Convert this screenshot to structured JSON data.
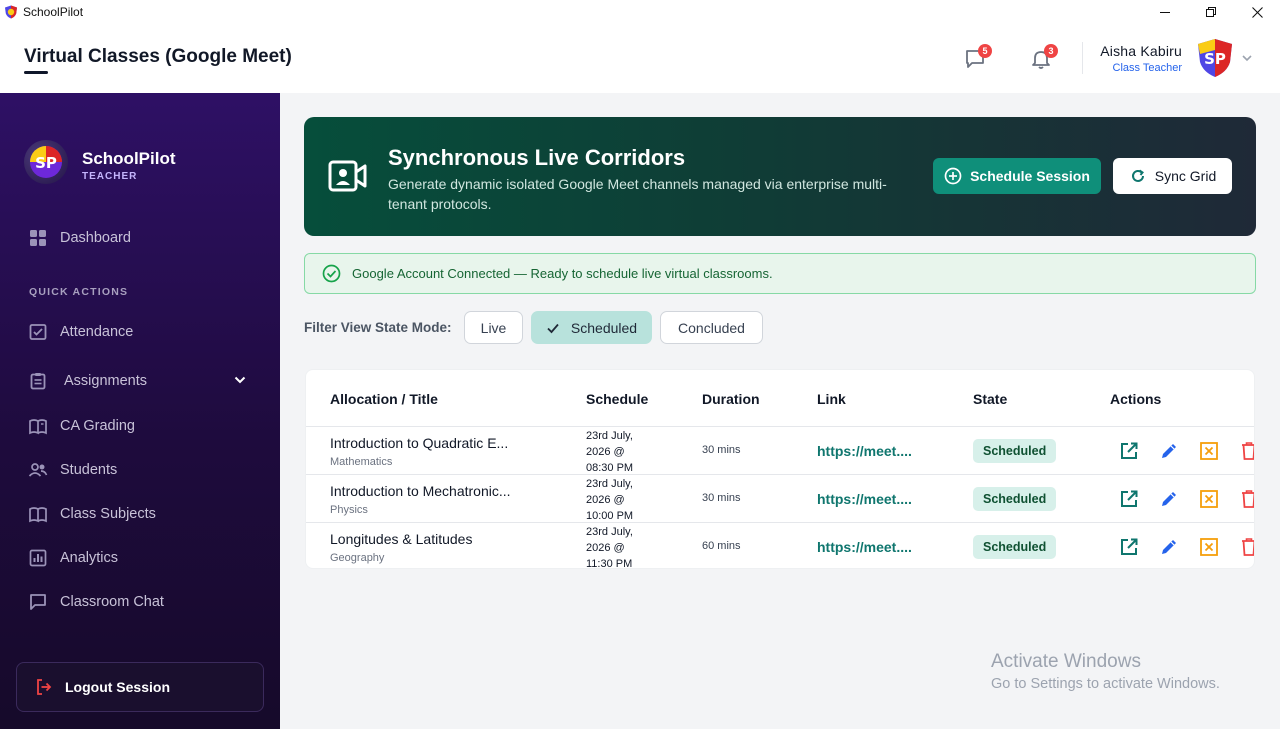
{
  "window": {
    "app_name": "SchoolPilot",
    "controls": [
      "minimize",
      "maximize",
      "close"
    ]
  },
  "header": {
    "title": "Virtual Classes (Google Meet)",
    "messages_badge": "5",
    "notifications_badge": "3",
    "user_name": "Aisha Kabiru",
    "user_role": "Class Teacher",
    "avatar_text": "SP"
  },
  "sidebar": {
    "brand_name": "SchoolPilot",
    "brand_role": "TEACHER",
    "brand_logo_text": "SP",
    "dashboard": "Dashboard",
    "section_label": "QUICK ACTIONS",
    "items": [
      {
        "label": "Attendance",
        "icon": "attendance-icon"
      },
      {
        "label": "Assignments",
        "icon": "assignments-icon"
      },
      {
        "label": "CA Grading",
        "icon": "grading-icon"
      },
      {
        "label": "Students",
        "icon": "students-icon"
      },
      {
        "label": "Class Subjects",
        "icon": "subjects-icon"
      },
      {
        "label": "Analytics",
        "icon": "analytics-icon"
      },
      {
        "label": "Classroom Chat",
        "icon": "chat-icon"
      }
    ],
    "logout": "Logout Session"
  },
  "hero": {
    "title": "Synchronous Live Corridors",
    "description": "Generate dynamic isolated Google Meet channels managed via enterprise multi-tenant protocols.",
    "schedule_button": "Schedule Session",
    "sync_button": "Sync Grid"
  },
  "alert": {
    "text": "Google Account Connected — Ready to schedule live virtual classrooms."
  },
  "filter": {
    "label": "Filter View State Mode:",
    "options": [
      "Live",
      "Scheduled",
      "Concluded"
    ],
    "selected": "Scheduled"
  },
  "table": {
    "columns": [
      "Allocation / Title",
      "Schedule",
      "Duration",
      "Link",
      "State",
      "Actions"
    ],
    "rows": [
      {
        "title": "Introduction to Quadratic E...",
        "subject": "Mathematics",
        "schedule_line1": "23rd July,",
        "schedule_line2": "2026 @",
        "schedule_line3": "08:30 PM",
        "duration": "30 mins",
        "link": "https://meet....",
        "state": "Scheduled"
      },
      {
        "title": "Introduction to Mechatronic...",
        "subject": "Physics",
        "schedule_line1": "23rd July,",
        "schedule_line2": "2026 @",
        "schedule_line3": "10:00 PM",
        "duration": "30 mins",
        "link": "https://meet....",
        "state": "Scheduled"
      },
      {
        "title": "Longitudes & Latitudes",
        "subject": "Geography",
        "schedule_line1": "23rd July,",
        "schedule_line2": "2026 @",
        "schedule_line3": "11:30 PM",
        "duration": "60 mins",
        "link": "https://meet....",
        "state": "Scheduled"
      }
    ]
  },
  "colors": {
    "sidebar": "#2e1065",
    "accent_teal": "#0f8f7a",
    "link": "#0f766e",
    "open_action": "#0f766e",
    "edit_action": "#2563eb",
    "cancel_action": "#f59e0b",
    "delete_action": "#ef4444"
  },
  "watermark": {
    "title": "Activate Windows",
    "subtitle": "Go to Settings to activate Windows."
  }
}
